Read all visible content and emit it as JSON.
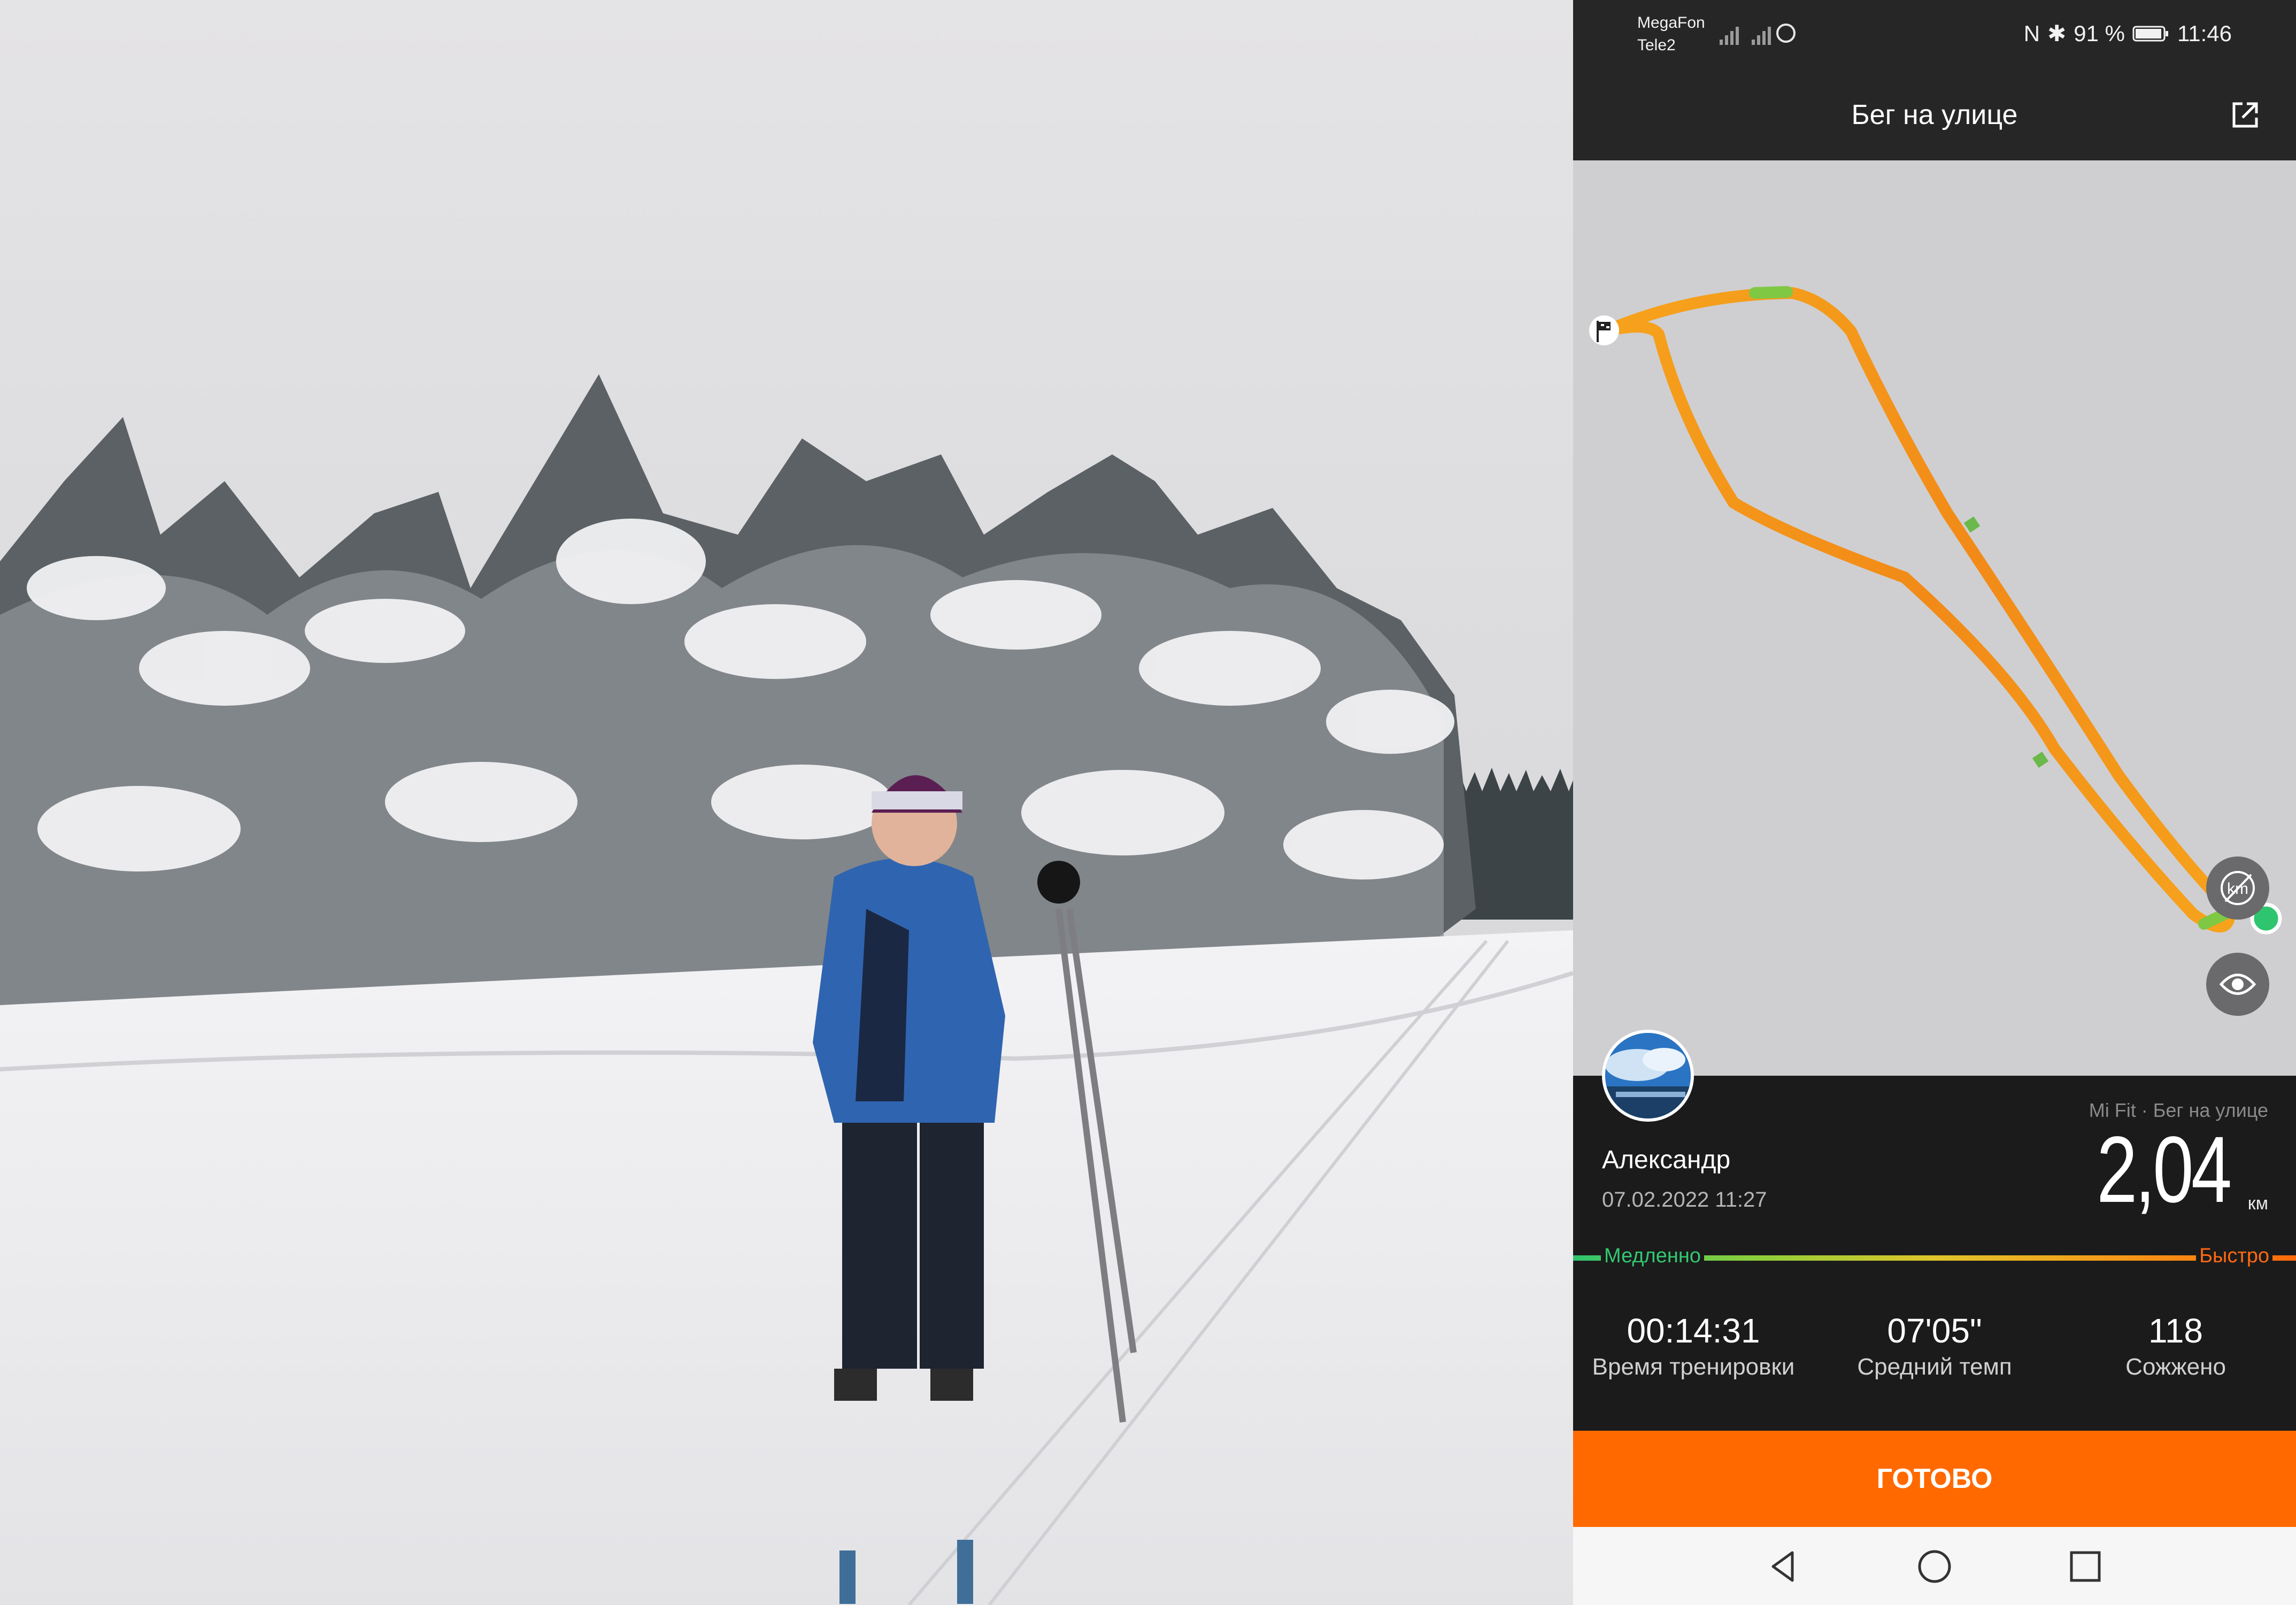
{
  "status_bar": {
    "carrier_1": "MegaFon",
    "carrier_2": "Tele2",
    "battery": "91 %",
    "time": "11:46"
  },
  "header": {
    "title": "Бег на улице"
  },
  "workout": {
    "user_name": "Александр",
    "date_time": "07.02.2022 11:27",
    "source": "Mi Fit · Бег на улице",
    "distance": "2,04",
    "distance_unit": "км",
    "pace_scale": {
      "slow_label": "Медленно",
      "fast_label": "Быстро"
    },
    "stats": [
      {
        "value": "00:14:31",
        "label": "Время тренировки"
      },
      {
        "value": "07'05\"",
        "label": "Средний темп"
      },
      {
        "value": "118",
        "label": "Сожжено"
      }
    ]
  },
  "actions": {
    "done_label": "ГОТОВО"
  },
  "colors": {
    "accent": "#ff6900",
    "slow": "#2fc46e",
    "fast": "#ff6a0b",
    "track": "#f7a21b"
  }
}
